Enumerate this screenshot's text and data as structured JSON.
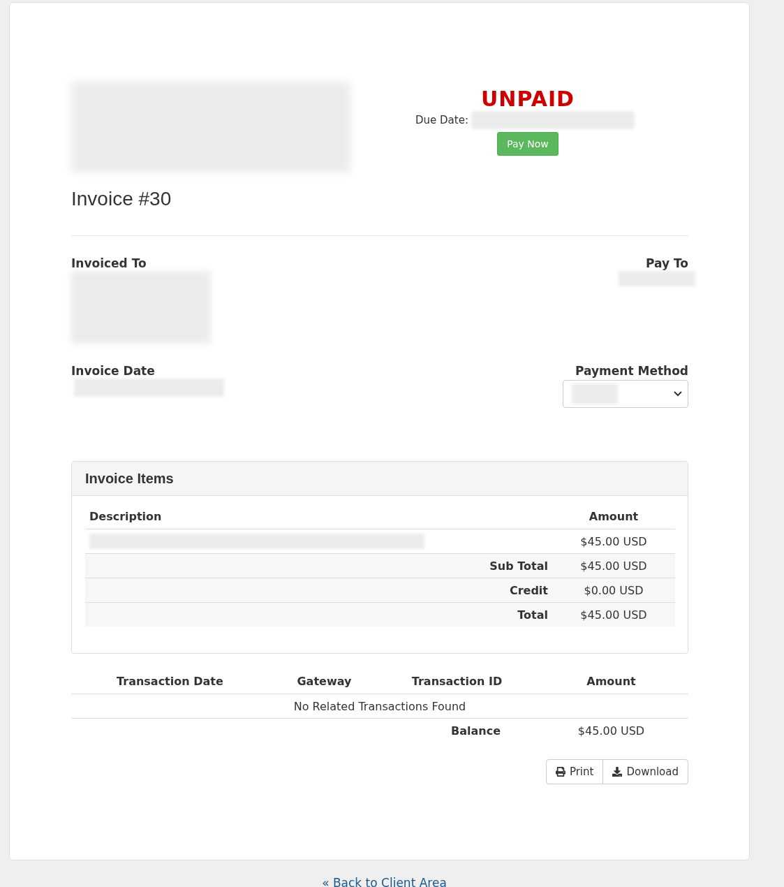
{
  "status": {
    "label": "UNPAID",
    "kind": "unpaid"
  },
  "due_date": {
    "label": "Due Date:"
  },
  "pay_button": {
    "label": "Pay Now"
  },
  "title": "Invoice #30",
  "invoiced_to": {
    "heading": "Invoiced To"
  },
  "pay_to": {
    "heading": "Pay To"
  },
  "invoice_date": {
    "heading": "Invoice Date"
  },
  "payment_method": {
    "heading": "Payment Method"
  },
  "invoice_items": {
    "title": "Invoice Items",
    "columns": [
      "Description",
      "Amount"
    ],
    "rows": [
      {
        "label": "",
        "amount": "$45.00 USD",
        "kind": "item"
      },
      {
        "label": "Sub Total",
        "amount": "$45.00 USD",
        "kind": "summary"
      },
      {
        "label": "Credit",
        "amount": "$0.00 USD",
        "kind": "summary"
      },
      {
        "label": "Total",
        "amount": "$45.00 USD",
        "kind": "summary"
      }
    ]
  },
  "transactions": {
    "columns": [
      "Transaction Date",
      "Gateway",
      "Transaction ID",
      "Amount"
    ],
    "empty_message": "No Related Transactions Found",
    "balance_label": "Balance",
    "balance_value": "$45.00 USD"
  },
  "actions": [
    {
      "label": "Print",
      "kind": "print"
    },
    {
      "label": "Download",
      "kind": "download"
    }
  ],
  "back_link": "« Back to Client Area"
}
